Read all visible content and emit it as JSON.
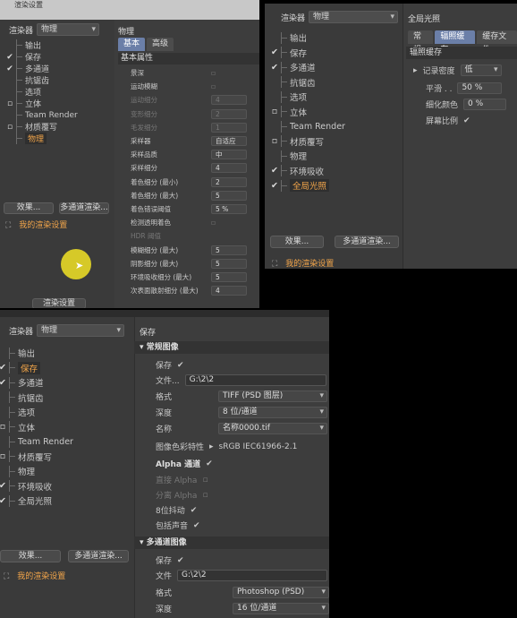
{
  "win1": {
    "title": "渲染设置",
    "renderer_label": "渲染器",
    "renderer_value": "物理",
    "tree": [
      {
        "label": "输出",
        "check": ""
      },
      {
        "label": "保存",
        "check": "✔"
      },
      {
        "label": "多通道",
        "check": "✔"
      },
      {
        "label": "抗锯齿",
        "check": ""
      },
      {
        "label": "选项",
        "check": ""
      },
      {
        "label": "立体",
        "check": "▫"
      },
      {
        "label": "Team Render",
        "check": ""
      },
      {
        "label": "材质覆写",
        "check": "▫"
      },
      {
        "label": "物理",
        "check": "",
        "active": true
      }
    ],
    "effects_btn": "效果...",
    "multipass_btn": "多通道渲染...",
    "my_settings": "我的渲染设置",
    "bottom_btn": "渲染设置",
    "header": "物理",
    "tabs": [
      "基本",
      "高级"
    ],
    "section": "基本属性",
    "props": [
      {
        "label": "景深",
        "value": "▫",
        "dim": false
      },
      {
        "label": "运动模糊",
        "value": "▫",
        "dim": false
      },
      {
        "label": "运动细分",
        "value": "4",
        "dim": true
      },
      {
        "label": "变形细分",
        "value": "2",
        "dim": true
      },
      {
        "label": "毛发细分",
        "value": "1",
        "dim": true
      },
      {
        "label": "采样器",
        "value": "自适应",
        "dim": false
      },
      {
        "label": "采样品质",
        "value": "中",
        "dim": false
      },
      {
        "label": "采样细分",
        "value": "4",
        "dim": false
      },
      {
        "label": "着色细分 (最小)",
        "value": "2",
        "dim": false
      },
      {
        "label": "着色细分 (最大)",
        "value": "5",
        "dim": false
      },
      {
        "label": "着色错误阈值",
        "value": "5 %",
        "dim": false
      },
      {
        "label": "检测透明着色",
        "value": "▫",
        "dim": false
      },
      {
        "label": "HDR 阈值",
        "value": "",
        "dim": true
      },
      {
        "label": "模糊细分 (最大)",
        "value": "5",
        "dim": false
      },
      {
        "label": "阴影细分 (最大)",
        "value": "5",
        "dim": false
      },
      {
        "label": "环境吸收细分 (最大)",
        "value": "5",
        "dim": false
      },
      {
        "label": "次表面散射细分 (最大)",
        "value": "4",
        "dim": false
      }
    ]
  },
  "win2": {
    "renderer_label": "渲染器",
    "renderer_value": "物理",
    "tree": [
      {
        "label": "输出",
        "check": ""
      },
      {
        "label": "保存",
        "check": "✔"
      },
      {
        "label": "多通道",
        "check": "✔"
      },
      {
        "label": "抗锯齿",
        "check": ""
      },
      {
        "label": "选项",
        "check": ""
      },
      {
        "label": "立体",
        "check": "▫"
      },
      {
        "label": "Team Render",
        "check": ""
      },
      {
        "label": "材质覆写",
        "check": "▫"
      },
      {
        "label": "物理",
        "check": ""
      },
      {
        "label": "环境吸收",
        "check": "✔"
      },
      {
        "label": "全局光照",
        "check": "✔",
        "active": true
      }
    ],
    "effects_btn": "效果...",
    "multipass_btn": "多通道渲染...",
    "my_settings": "我的渲染设置",
    "header": "全局光照",
    "tabs": [
      "常规",
      "辐照缓存",
      "缓存文件"
    ],
    "section": "辐照缓存",
    "record_label": "记录密度",
    "record_value": "低",
    "smooth_label": "平滑 . .",
    "smooth_value": "50 %",
    "color_label": "细化颜色",
    "color_value": "0 %",
    "scale_label": "屏幕比例",
    "scale_value": "✔"
  },
  "win3": {
    "renderer_label": "渲染器",
    "renderer_value": "物理",
    "tree": [
      {
        "label": "输出",
        "check": ""
      },
      {
        "label": "保存",
        "check": "✔",
        "active": true
      },
      {
        "label": "多通道",
        "check": "✔"
      },
      {
        "label": "抗锯齿",
        "check": ""
      },
      {
        "label": "选项",
        "check": ""
      },
      {
        "label": "立体",
        "check": "▫"
      },
      {
        "label": "Team Render",
        "check": ""
      },
      {
        "label": "材质覆写",
        "check": "▫"
      },
      {
        "label": "物理",
        "check": ""
      },
      {
        "label": "环境吸收",
        "check": "✔"
      },
      {
        "label": "全局光照",
        "check": "✔"
      }
    ],
    "effects_btn": "效果...",
    "multipass_btn": "多通道渲染...",
    "my_settings": "我的渲染设置",
    "header": "保存",
    "group1": "常规图像",
    "save_label": "保存",
    "save_value": "✔",
    "file_label": "文件...",
    "file_value": "G:\\2\\2",
    "format_label": "格式",
    "format_value": "TIFF (PSD 图层)",
    "depth_label": "深度",
    "depth_value": "8 位/通道",
    "name_label": "名称",
    "name_value": "名称0000.tif",
    "profile_label": "图像色彩特性",
    "profile_value": "sRGB IEC61966-2.1",
    "alpha_label": "Alpha 通道",
    "alpha_value": "✔",
    "straight_label": "直接 Alpha",
    "separate_label": "分离 Alpha",
    "dither_label": "8位抖动",
    "dither_value": "✔",
    "sound_label": "包括声音",
    "sound_value": "✔",
    "group2": "多通道图像",
    "save2_label": "保存",
    "save2_value": "✔",
    "file2_label": "文件",
    "file2_value": "G:\\2\\2",
    "format2_label": "格式",
    "format2_value": "Photoshop (PSD)",
    "depth2_label": "深度",
    "depth2_value": "16 位/通道"
  }
}
